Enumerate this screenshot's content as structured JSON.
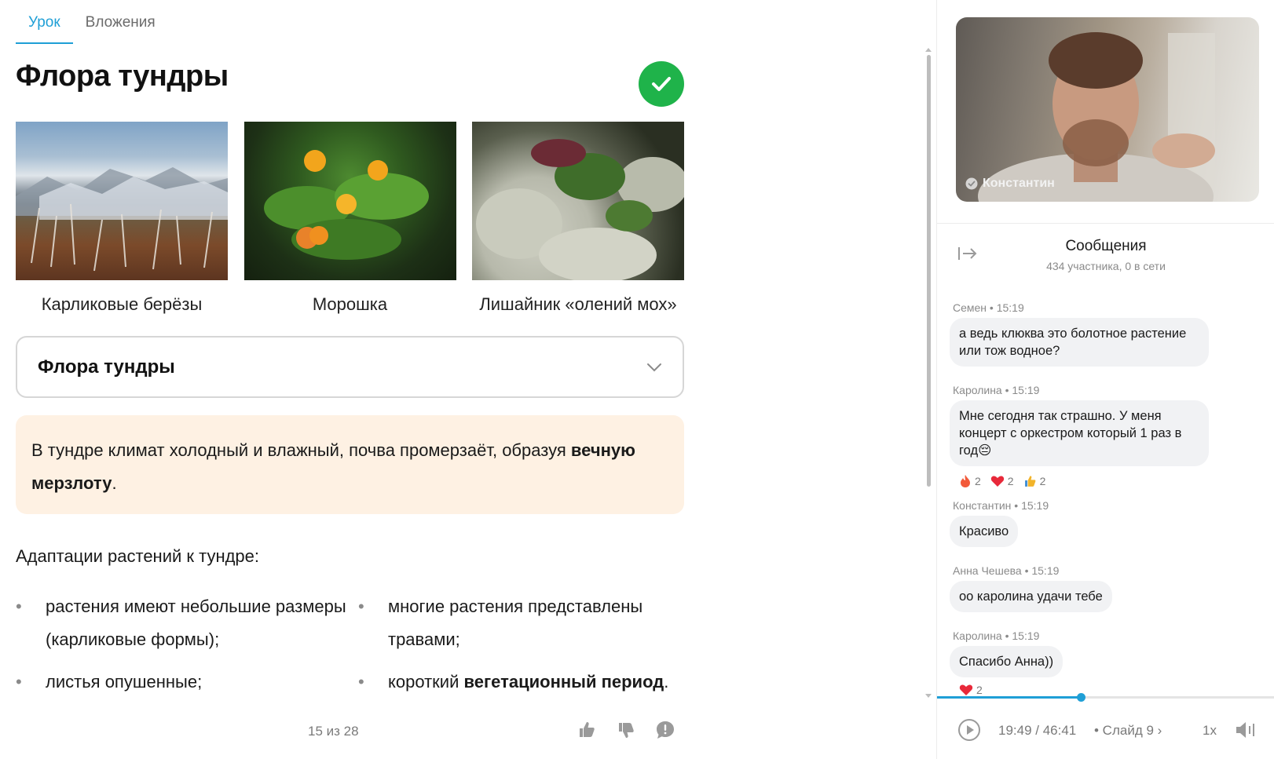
{
  "tabs": [
    {
      "label": "Урок",
      "active": true
    },
    {
      "label": "Вложения",
      "active": false
    }
  ],
  "lesson": {
    "title": "Флора тундры",
    "completed": true,
    "gallery": [
      {
        "caption": "Карликовые берёзы",
        "image": "dwarf-birch-photo"
      },
      {
        "caption": "Морошка",
        "image": "cloudberry-photo"
      },
      {
        "caption": "Лишайник «олений мох»",
        "image": "reindeer-lichen-photo"
      }
    ],
    "accordion_title": "Флора тундры",
    "note_text": "В тундре климат холодный и влажный, почва промерзаёт, образуя ",
    "note_bold": "вечную мерзлоту",
    "note_end": ".",
    "adapt_heading": "Адаптации растений к тундре:",
    "bullets": [
      {
        "text": "растения имеют небольшие размеры (карликовые формы);",
        "bold": "",
        "end": ""
      },
      {
        "text": "многие растения представлены травами;",
        "bold": "",
        "end": ""
      },
      {
        "text": "листья опушенные;",
        "bold": "",
        "end": ""
      },
      {
        "text": "короткий ",
        "bold": "вегетационный период",
        "end": "."
      }
    ],
    "page_indicator": "15 из 28"
  },
  "video": {
    "presenter_name": "Константин"
  },
  "chat": {
    "title": "Сообщения",
    "subtitle": "434 участника, 0 в сети",
    "messages": [
      {
        "author": "Семен",
        "time": "15:19",
        "meta": "Семен • 15:19",
        "text": "а ведь клюква это болотное растение или тож водное?",
        "reactions": []
      },
      {
        "author": "Каролина",
        "time": "15:19",
        "meta": "Каролина • 15:19",
        "text": "Мне сегодня так страшно. У меня концерт с оркестром который 1 раз в год😔",
        "reactions": [
          {
            "emoji": "👍",
            "icon": "fire-reaction-icon",
            "count": "2"
          },
          {
            "emoji": "❤",
            "icon": "heart-reaction-icon",
            "count": "2"
          },
          {
            "emoji": "👍",
            "icon": "thumbs-up-reaction-icon",
            "count": "2"
          }
        ]
      },
      {
        "author": "Константин",
        "time": "15:19",
        "meta": "Константин • 15:19",
        "text": "Красиво",
        "reactions": []
      },
      {
        "author": "Анна Чешева",
        "time": "15:19",
        "meta": "Анна Чешева • 15:19",
        "text": "оо каролина удачи тебе",
        "reactions": []
      },
      {
        "author": "Каролина",
        "time": "15:19",
        "meta": "Каролина • 15:19",
        "text": "Спасибо Анна))",
        "reactions": [
          {
            "emoji": "❤",
            "icon": "heart-reaction-icon",
            "count": "2"
          }
        ]
      }
    ]
  },
  "player": {
    "current_time": "19:49",
    "total_time": "46:41",
    "time_label": "19:49 / 46:41",
    "slide_label": "• Слайд 9",
    "speed": "1x",
    "progress_fraction": 0.425
  },
  "colors": {
    "accent": "#1f9fd6",
    "success": "#1fb34a",
    "note_bg": "#fef1e3",
    "bubble_bg": "#f1f2f4"
  }
}
